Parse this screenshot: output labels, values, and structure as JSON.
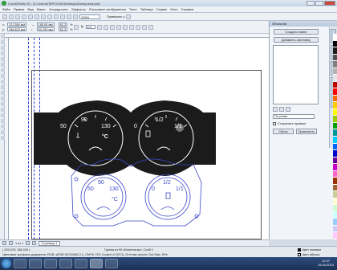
{
  "window": {
    "title": "CorelDRAW X5 - [C:\\Users\\ПЕРСОНА\\Desktop\\Datchy.tempcdr]"
  },
  "menu": [
    "Файл",
    "Правка",
    "Вид",
    "Макет",
    "Упорядочить",
    "Эффекты",
    "Растровые изображения",
    "Текст",
    "Таблица",
    "Сервис",
    "Окно",
    "Справка"
  ],
  "toolbar": {
    "zoom": "100%",
    "snap_label": "Привязать к"
  },
  "properties": {
    "x": "121,568 мм",
    "y": "186,823 мм",
    "w": "165,06 мм",
    "h": "52,153 мм",
    "scale_w": "82,3",
    "scale_h": "82,3",
    "angle": "0,0"
  },
  "docker": {
    "title": "Объектив",
    "create_btn": "Создать новое",
    "add_btn": "Добавить заготовку",
    "select_value": "По углам",
    "checkbox_label": "Сохранить прямые",
    "reset_btn": "Сброс",
    "apply_btn": "Применить"
  },
  "gauge_top": {
    "left_dial": {
      "label1": "50",
      "label2": "90",
      "label3": "130",
      "unit": "°C"
    },
    "right_dial": {
      "label1": "0",
      "label2": "1/2",
      "label3": "1/1"
    }
  },
  "gauge_bottom": {
    "left_dial": {
      "label1": "50",
      "label2": "90",
      "label3": "130",
      "unit": "°C"
    },
    "right_dial": {
      "label1": "0",
      "label2": "1/2",
      "label3": "1/1"
    }
  },
  "page_nav": {
    "counter": "1 из 1",
    "page_tab": "Страница 1"
  },
  "status": {
    "coords": "( 226,076; 188,326 )",
    "group_info": "Группа из 90 объектов вкл. Слой 1",
    "color_profile": "Цветовые профили документа: RGB: sRGB IEC61966-2.1; CMYK: ISO Coated v2 (ECI); Оттенки серого: Dot Gain 15%",
    "fill_label": "Цвет заливки",
    "outline_label": "Цвет абриса"
  },
  "taskbar": {
    "time": "12:37",
    "date": "15.04.2013"
  },
  "colors": {
    "gauge_dark": "#1b1b1b",
    "outline_blue": "#3d48c8",
    "guide_blue": "#2a3ad0"
  },
  "palette": [
    "#ffffff",
    "#000000",
    "#1a1a1a",
    "#4d4d4d",
    "#808080",
    "#b3b3b3",
    "#e6e6e6",
    "#c00000",
    "#ff0000",
    "#ff6600",
    "#ffcc00",
    "#ffff00",
    "#99cc00",
    "#00a000",
    "#009999",
    "#00ccff",
    "#0066ff",
    "#0000cc",
    "#660099",
    "#cc00cc",
    "#ff66cc",
    "#993300",
    "#996633",
    "#cccc99",
    "#ffffcc",
    "#ccffcc",
    "#ccffff",
    "#99ccff",
    "#ccccff",
    "#ffccff"
  ]
}
